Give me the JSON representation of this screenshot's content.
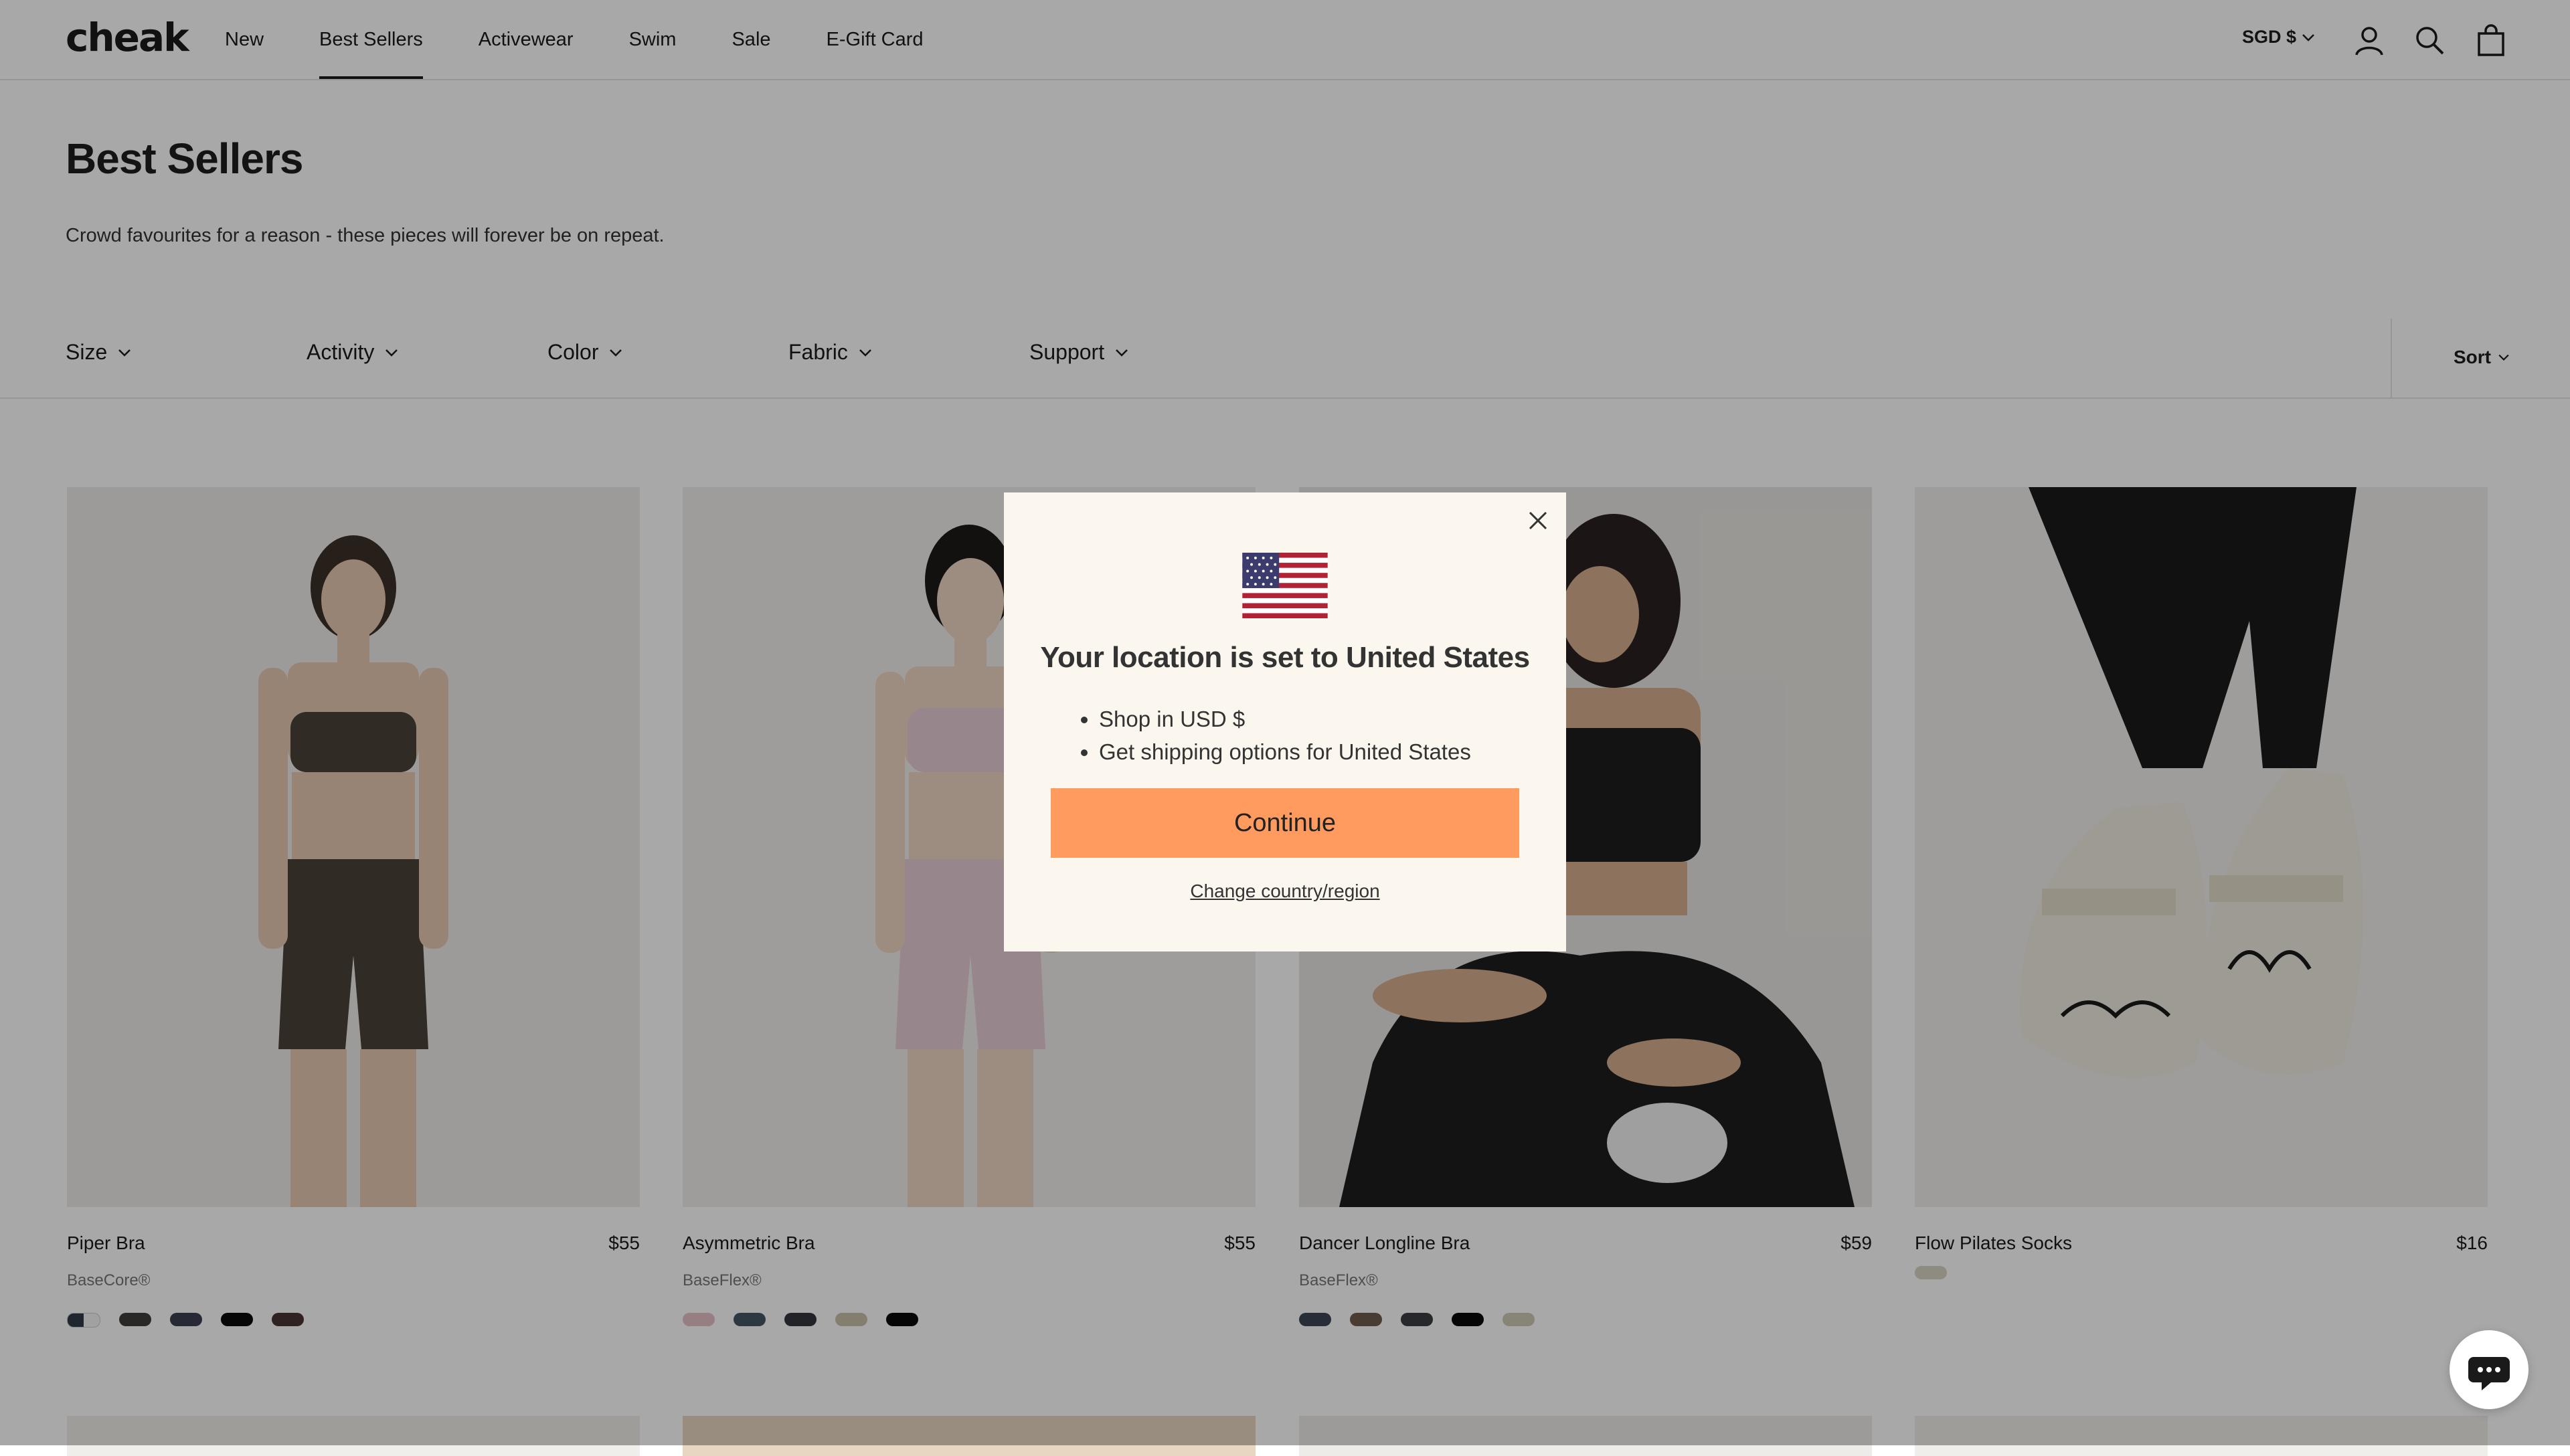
{
  "header": {
    "logo": "cheak",
    "nav": [
      "New",
      "Best Sellers",
      "Activewear",
      "Swim",
      "Sale",
      "E-Gift Card"
    ],
    "active_nav": "Best Sellers",
    "currency": "SGD $",
    "icons": [
      "account-icon",
      "search-icon",
      "cart-icon"
    ]
  },
  "page": {
    "title": "Best Sellers",
    "description": "Crowd favourites for a reason - these pieces will forever be on repeat."
  },
  "filters": [
    "Size",
    "Activity",
    "Color",
    "Fabric",
    "Support"
  ],
  "sort_label": "Sort",
  "products": [
    {
      "name": "Piper Bra",
      "price": "$55",
      "fabric": "BaseCore®",
      "swatches": [
        "#2f3a4a",
        "#3f3e3c",
        "#3c4150",
        "#0a0a0a",
        "#4a3432"
      ],
      "bg": "#eeece8",
      "color": "#4a4238"
    },
    {
      "name": "Asymmetric Bra",
      "price": "$55",
      "fabric": "BaseFlex®",
      "swatches": [
        "#e6bfc7",
        "#465564",
        "#33363f",
        "#c9c0a8",
        "#0a0a0a"
      ],
      "bg": "#f2efeb",
      "color": "#e6cbd4"
    },
    {
      "name": "Dancer Longline Bra",
      "price": "$59",
      "fabric": "BaseFlex®",
      "swatches": [
        "#3d4756",
        "#6e5b4e",
        "#3b3e44",
        "#0a0a0a",
        "#cfc8b4"
      ],
      "bg": "#e8e6e2",
      "color": "#1e1e1e"
    },
    {
      "name": "Flow Pilates Socks",
      "price": "$16",
      "fabric": "",
      "swatches": [
        "#d8d3c2"
      ],
      "bg": "#f1efec",
      "color": "#1a1a1a"
    }
  ],
  "modal": {
    "title": "Your location is set to United States",
    "bullets": [
      "Shop in USD $",
      "Get shipping options for United States"
    ],
    "continue_label": "Continue",
    "change_label": "Change country/region",
    "accent": "#ff9b5f"
  },
  "colors": {
    "overlay": "rgba(0,0,0,0.34)",
    "modal_bg": "#fbf7ef"
  }
}
